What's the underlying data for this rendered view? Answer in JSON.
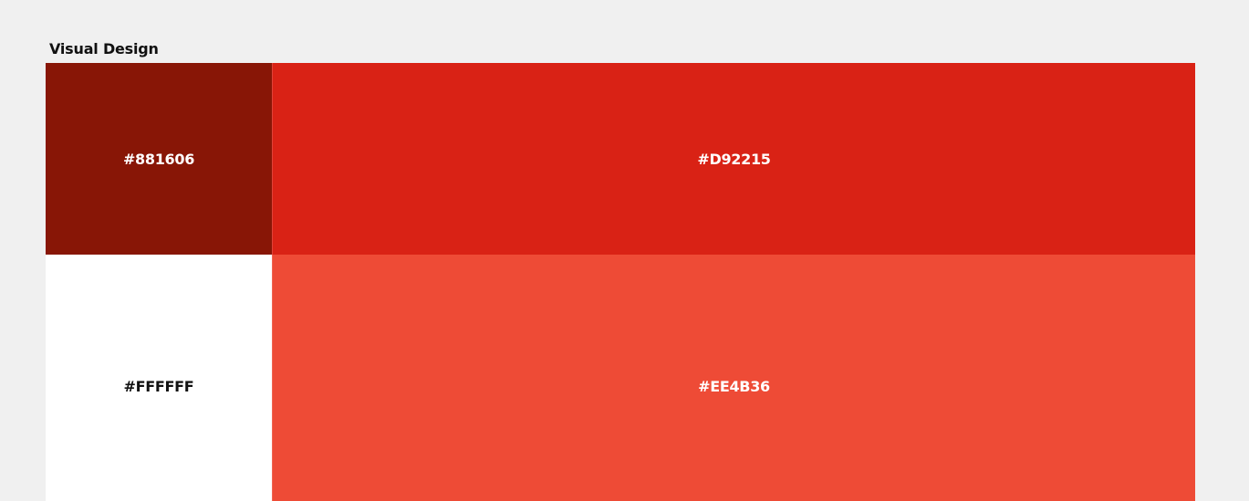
{
  "section": {
    "title": "Visual Design"
  },
  "swatches": [
    {
      "label": "#881606",
      "color": "#881606",
      "text_color": "#ffffff"
    },
    {
      "label": "#D92215",
      "color": "#D92215",
      "text_color": "#ffffff"
    },
    {
      "label": "#FFFFFF",
      "color": "#FFFFFF",
      "text_color": "#111111"
    },
    {
      "label": "#EE4B36",
      "color": "#EE4B36",
      "text_color": "#ffffff"
    }
  ]
}
